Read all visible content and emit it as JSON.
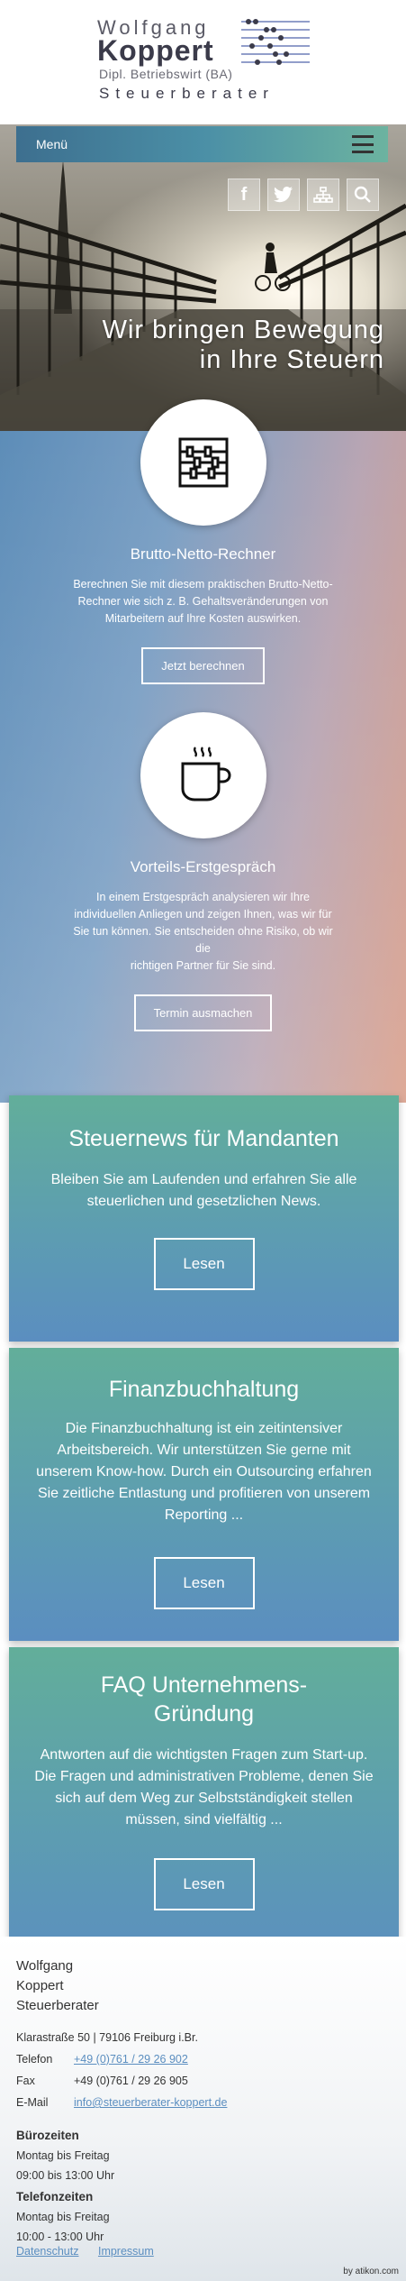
{
  "logo": {
    "line1": "Wolfgang",
    "line2": "Koppert",
    "line3": "Dipl. Betriebswirt (BA)",
    "line4": "Steuerberater"
  },
  "nav": {
    "menu_label": "Menü"
  },
  "hero": {
    "tagline_1": "Wir bringen Bewegung",
    "tagline_2": "in Ihre Steuern",
    "social": [
      "facebook-icon",
      "twitter-icon",
      "sitemap-icon",
      "search-icon"
    ]
  },
  "services": [
    {
      "icon": "abacus-icon",
      "title": "Brutto-Netto-Rechner",
      "text": "Berechnen Sie mit diesem praktischen Brutto-Netto-Rechner wie sich z. B. Gehaltsveränderungen von Mitarbeitern auf Ihre Kosten auswirken.",
      "button": "Jetzt berechnen"
    },
    {
      "icon": "coffee-cup-icon",
      "title": "Vorteils-Erstgespräch",
      "text_1": "In einem Erstgespräch analysieren wir Ihre individuellen Anliegen und zeigen Ihnen, was wir für Sie tun können. Sie entscheiden ohne Risiko, ob wir die",
      "text_2": "richtigen Partner für Sie sind.",
      "button": "Termin ausmachen"
    }
  ],
  "cards": [
    {
      "title": "Steuernews für Mandanten",
      "text": "Bleiben Sie am Laufenden und erfahren Sie alle steuerlichen und gesetzlichen News.",
      "button": "Lesen"
    },
    {
      "title": "Finanzbuchhaltung",
      "text": "Die Finanzbuchhaltung ist ein zeitintensiver Arbeitsbereich. Wir unterstützen Sie gerne mit unserem Know-how. Durch ein Outsourcing erfahren Sie zeitliche Entlastung und profitieren von unserem Reporting ...",
      "button": "Lesen"
    },
    {
      "title": "FAQ Unternehmens-Gründung",
      "title_1": "FAQ Unternehmens-",
      "title_2": "Gründung",
      "text": "Antworten auf die wichtigsten Fragen zum Start-up. Die Fragen und administrativen Probleme, denen Sie sich auf dem Weg zur Selbstständigkeit stellen müssen, sind vielfältig ...",
      "button": "Lesen"
    }
  ],
  "footer": {
    "name_1": "Wolfgang",
    "name_2": "Koppert",
    "name_3": "Steuerberater",
    "address": "Klarastraße 50 | 79106 Freiburg i.Br.",
    "phone_label": "Telefon",
    "phone": "+49 (0)761 / 29 26 902",
    "fax_label": "Fax",
    "fax": "+49 (0)761 / 29 26 905",
    "email_label": "E-Mail",
    "email": "info@steuerberater-koppert.de",
    "office_heading": "Bürozeiten",
    "office_days": "Montag bis Freitag",
    "office_hours": "09:00 bis 13:00 Uhr",
    "phone_heading": "Telefonzeiten",
    "phone_days": "Montag bis Freitag",
    "phone_hours": "10:00 - 13:00 Uhr",
    "link_privacy": "Datenschutz",
    "link_imprint": "Impressum",
    "credit": "by atikon.com"
  },
  "colors": {
    "accent_teal": "#62ae9a",
    "accent_blue": "#5b8ec0",
    "band_left": "#5d8db8",
    "band_right": "#d89b86"
  }
}
